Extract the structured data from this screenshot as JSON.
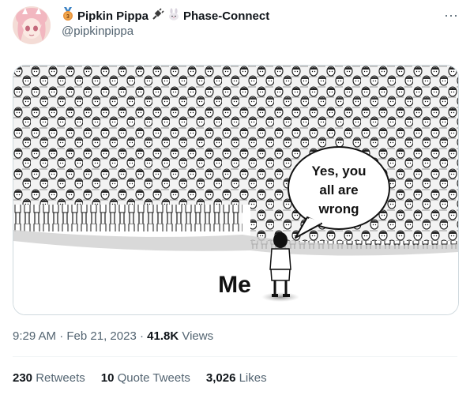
{
  "author": {
    "display_name": "Pipkin Pippa",
    "affiliation": "Phase-Connect",
    "handle": "@pipkinpippa",
    "badge_icon": "medal-icon",
    "badge_number": "3"
  },
  "tweet": {
    "time": "9:29 AM",
    "date": "Feb 21, 2023",
    "separator": "·",
    "views_count": "41.8K",
    "views_label": "Views"
  },
  "meme": {
    "bubble_line1": "Yes, you",
    "bubble_line2": "all are",
    "bubble_line3": "wrong",
    "me_label": "Me"
  },
  "stats": {
    "retweets_count": "230",
    "retweets_label": "Retweets",
    "quotes_count": "10",
    "quotes_label": "Quote Tweets",
    "likes_count": "3,026",
    "likes_label": "Likes"
  },
  "menu": {
    "more_glyph": "···"
  },
  "colors": {
    "secondary_text": "#536471",
    "primary_text": "#0f1419",
    "border": "#cfd9de"
  }
}
